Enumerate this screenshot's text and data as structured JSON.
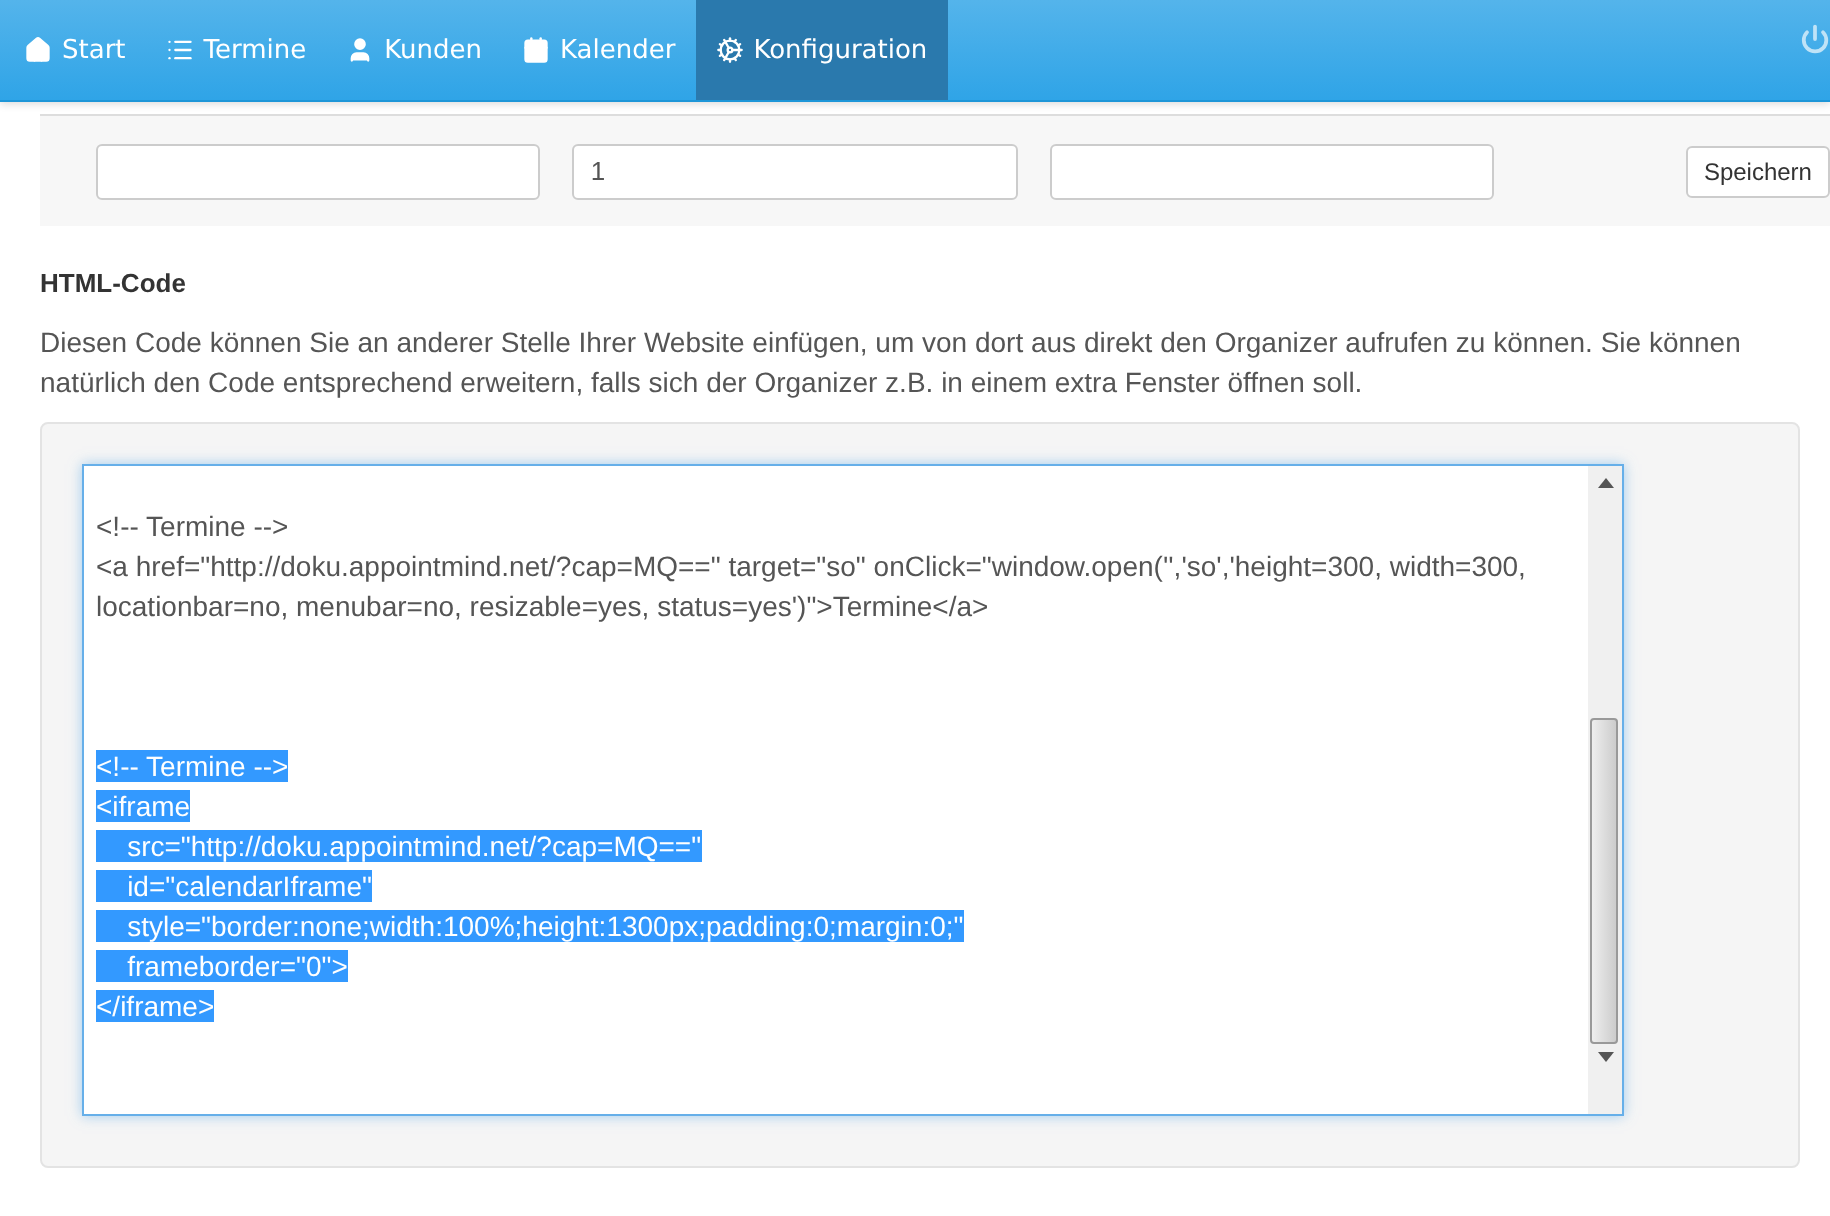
{
  "nav": {
    "items": [
      {
        "label": "Start",
        "selected": false
      },
      {
        "label": "Termine",
        "selected": false
      },
      {
        "label": "Kunden",
        "selected": false
      },
      {
        "label": "Kalender",
        "selected": false
      },
      {
        "label": "Konfiguration",
        "selected": true
      }
    ]
  },
  "form": {
    "field_2": {
      "value": "1"
    },
    "button": "Speichern"
  },
  "section": {
    "title": "HTML-Code",
    "description": "Diesen Code können Sie an anderer Stelle Ihrer Website einfügen, um von dort aus direkt den Organizer aufrufen zu können. Sie können natürlich den Code entsprechend erweitern, falls sich der Organizer z.B. in einem extra Fenster öffnen soll."
  },
  "code": {
    "blocks": [
      {
        "selected": false,
        "lines": [
          "<!-- Termine -->",
          "<a href=\"http://doku.appointmind.net/?cap=MQ==\" target=\"so\" onClick=\"window.open('','so','height=300, width=300, locationbar=no, menubar=no, resizable=yes, status=yes')\">Termine</a>"
        ]
      },
      {
        "selected": true,
        "lines": [
          "<!-- Termine -->",
          "<iframe",
          "    src=\"http://doku.appointmind.net/?cap=MQ==\"",
          "    id=\"calendarIframe\"",
          "    style=\"border:none;width:100%;height:1300px;padding:0;margin:0;\"",
          "    frameborder=\"0\">",
          "</iframe>"
        ]
      }
    ]
  }
}
